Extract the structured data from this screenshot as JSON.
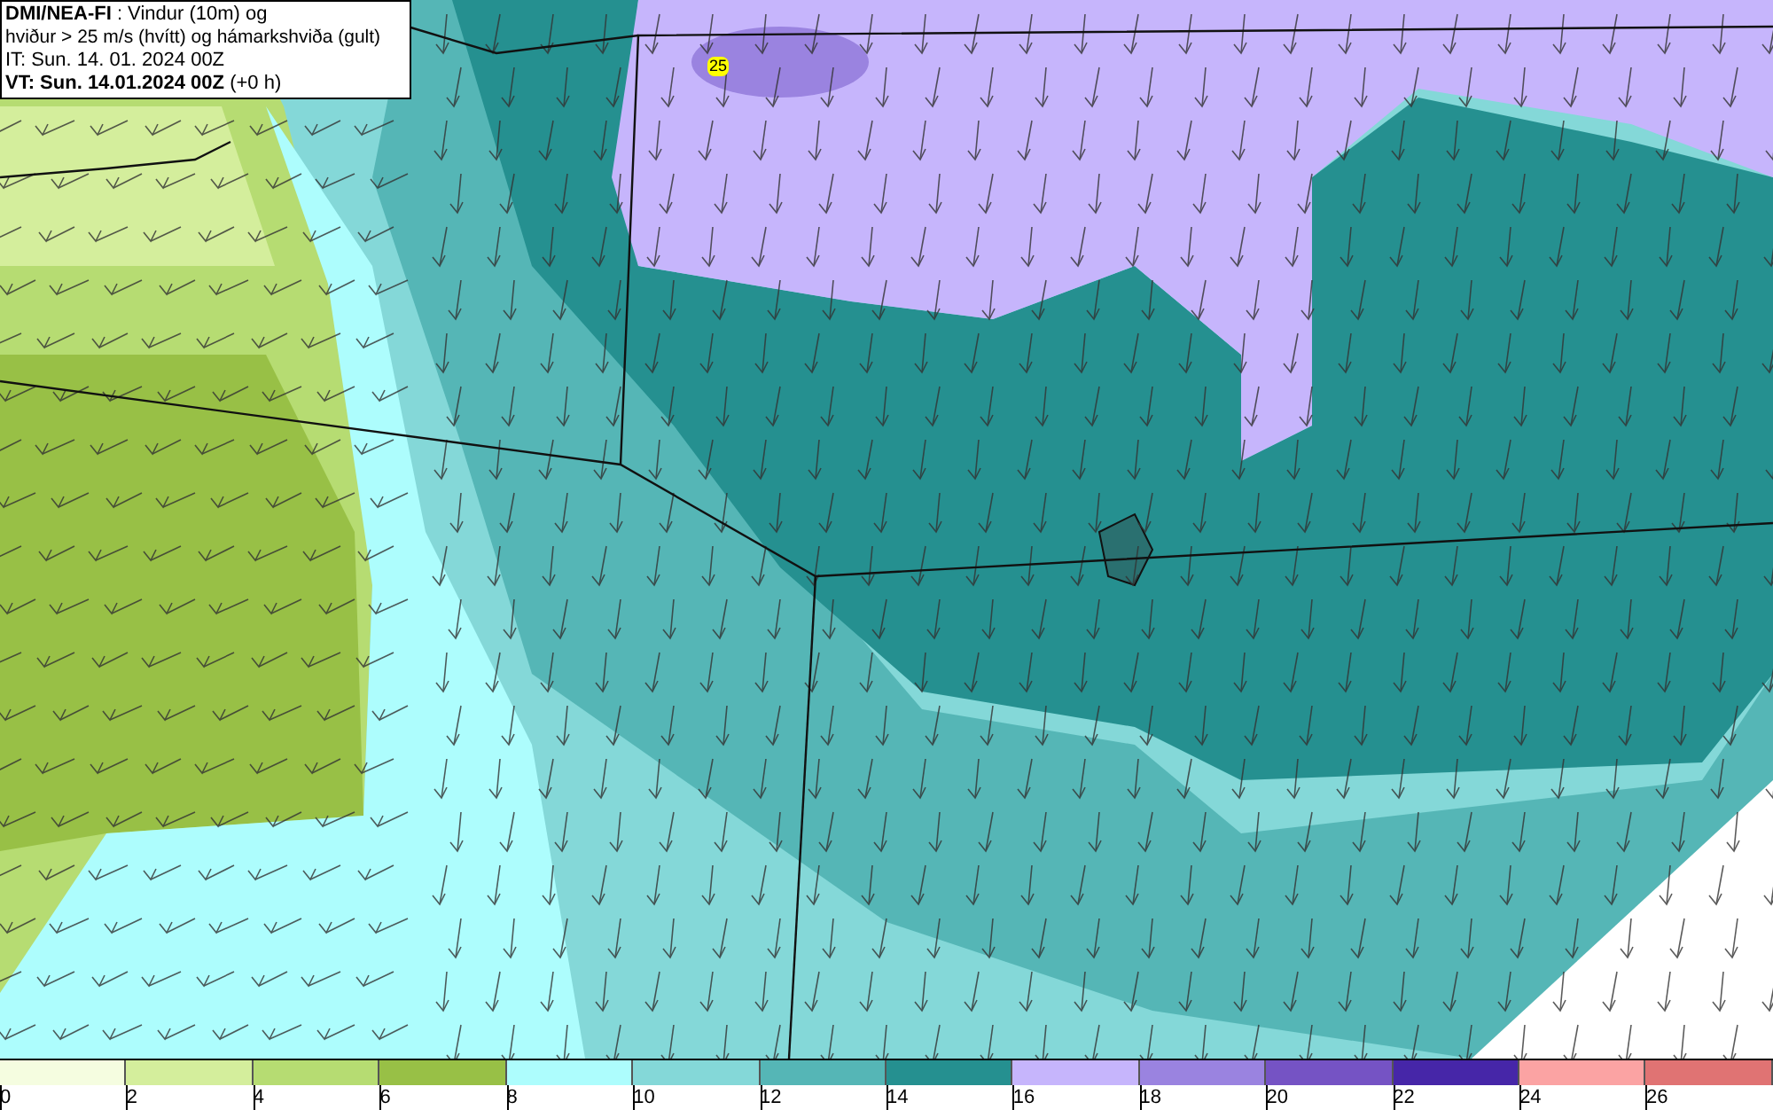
{
  "header": {
    "title": "**DMI/NEA-FI** : Vindur (10m) og",
    "subtitle": "hviður > 25 m/s (hvítt) og hámarkshviða (gult)",
    "issue_time": "IT: Sun. 14. 01. 2024 00Z",
    "valid_time": "**VT: Sun. 14.01.2024 00Z** (+0 h)"
  },
  "map": {
    "gust_label": "25"
  },
  "legend": [
    {
      "label": "0",
      "color": "#f5fde0"
    },
    {
      "label": "2",
      "color": "#d4ee9c"
    },
    {
      "label": "4",
      "color": "#b6dc72"
    },
    {
      "label": "6",
      "color": "#98c046"
    },
    {
      "label": "8",
      "color": "#adfdfd"
    },
    {
      "label": "10",
      "color": "#84d8d8"
    },
    {
      "label": "12",
      "color": "#55b6b6"
    },
    {
      "label": "14",
      "color": "#259090"
    },
    {
      "label": "16",
      "color": "#c6b5fc"
    },
    {
      "label": "18",
      "color": "#9a83e0"
    },
    {
      "label": "20",
      "color": "#7553c4"
    },
    {
      "label": "22",
      "color": "#4626a8"
    },
    {
      "label": "24",
      "color": "#fba3a3"
    },
    {
      "label": "26",
      "color": "#e07373"
    }
  ]
}
